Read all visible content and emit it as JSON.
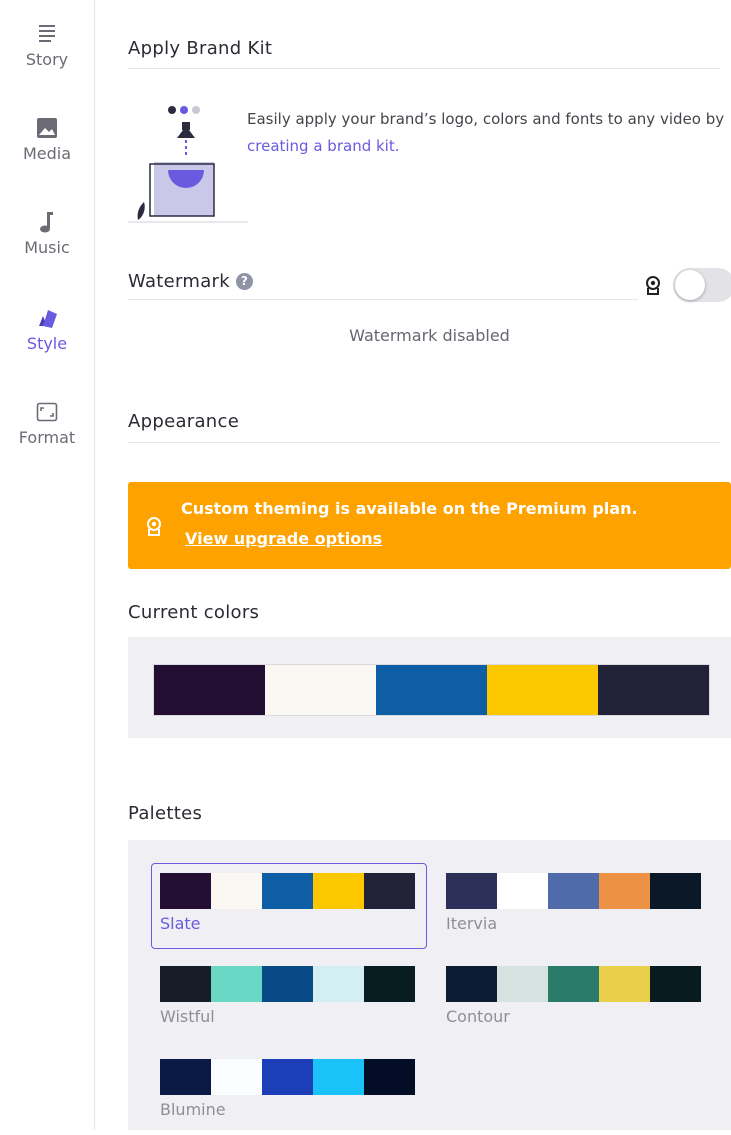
{
  "sidebar": {
    "items": [
      {
        "label": "Story",
        "icon": "story-lines-icon"
      },
      {
        "label": "Media",
        "icon": "image-icon"
      },
      {
        "label": "Music",
        "icon": "music-note-icon"
      },
      {
        "label": "Style",
        "icon": "style-swatches-icon",
        "active": true
      },
      {
        "label": "Format",
        "icon": "format-frame-icon"
      }
    ]
  },
  "brand_kit": {
    "title": "Apply Brand Kit",
    "text_before": "Easily apply your brand’s logo, colors and fonts to any video by ",
    "link_text": "creating a brand kit."
  },
  "watermark": {
    "title": "Watermark",
    "help_glyph": "?",
    "enabled": false,
    "status": "Watermark disabled"
  },
  "appearance": {
    "title": "Appearance"
  },
  "upgrade_banner": {
    "message": "Custom theming is available on the Premium plan.",
    "link": "View upgrade options",
    "color": "#fea200"
  },
  "current_colors": {
    "title": "Current colors",
    "swatches": [
      "#220f33",
      "#fbf7f2",
      "#0e5ea6",
      "#fdc700",
      "#212238"
    ]
  },
  "palettes": {
    "title": "Palettes",
    "items": [
      {
        "name": "Slate",
        "colors": [
          "#220f33",
          "#fbf7f2",
          "#0e5ea6",
          "#fdc700",
          "#212238"
        ],
        "selected": true
      },
      {
        "name": "Itervia",
        "colors": [
          "#2c2f57",
          "#ffffff",
          "#506baa",
          "#ed9245",
          "#0b1828"
        ],
        "selected": false
      },
      {
        "name": "Wistful",
        "colors": [
          "#161d26",
          "#6ad7c5",
          "#074a85",
          "#d3eff2",
          "#081d1f"
        ],
        "selected": false
      },
      {
        "name": "Contour",
        "colors": [
          "#0d1b33",
          "#d4e3df",
          "#2b7b6b",
          "#ead04a",
          "#081c20"
        ],
        "selected": false
      },
      {
        "name": "Blumine",
        "colors": [
          "#0b1a44",
          "#fafdff",
          "#1c3eb7",
          "#19c2f7",
          "#030d26"
        ],
        "selected": false
      }
    ]
  },
  "accent_color": "#6a5ae0"
}
